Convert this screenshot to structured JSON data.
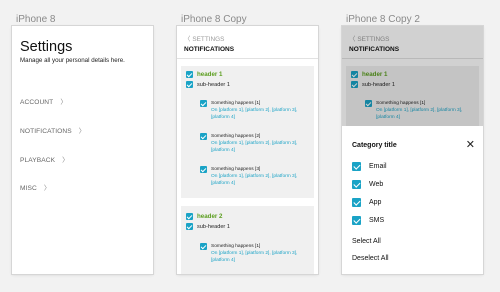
{
  "artboards": {
    "a1_label": "iPhone 8",
    "a2_label": "iPhone 8 Copy",
    "a3_label": "iPhone 8 Copy 2"
  },
  "settings": {
    "title": "Settings",
    "subtitle": "Manage all your personal details here.",
    "chevron": "〉",
    "menu": [
      "ACCOUNT",
      "NOTIFICATIONS",
      "PLAYBACK",
      "MISC"
    ]
  },
  "notifications": {
    "back_glyph": "〈",
    "back_label": "SETTINGS",
    "title": "NOTIFICATIONS",
    "groups": [
      {
        "header": "header 1",
        "subheader": "sub-header 1",
        "items": [
          {
            "title": "Something happens [1]",
            "desc": "On [platform 1], [platform 2], [platform 3], [platform 4]"
          },
          {
            "title": "Something happens [2]",
            "desc": "On [platform 1], [platform 2], [platform 3], [platform 4]"
          },
          {
            "title": "Something happens [3]",
            "desc": "On [platform 1], [platform 2], [platform 3], [platform 4]"
          }
        ]
      },
      {
        "header": "header 2",
        "subheader": "sub-header 1",
        "items": [
          {
            "title": "Something happens [1]",
            "desc": "On [platform 1], [platform 2], [platform 3], [platform 4]"
          }
        ]
      }
    ]
  },
  "category_sheet": {
    "title": "Category title",
    "close_glyph": "✕",
    "options": [
      "Email",
      "Web",
      "App",
      "SMS"
    ],
    "select_all": "Select All",
    "deselect_all": "Deselect All"
  },
  "colors": {
    "accent": "#1aa3c6",
    "header_green": "#5b9e1f",
    "card_bg": "#f0f0f0"
  }
}
